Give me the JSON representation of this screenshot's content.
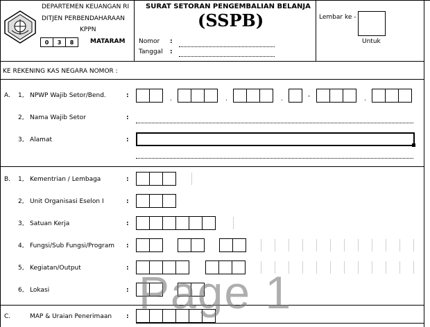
{
  "header": {
    "dept_line1": "DEPARTEMEN KEUANGAN RI",
    "dept_line2": "DITJEN PERBENDAHARAAN",
    "kppn_label": "KPPN",
    "kppn_code": [
      "0",
      "3",
      "8"
    ],
    "kppn_name": "MATARAM",
    "title": "SURAT SETORAN PENGEMBALIAN BELANJA",
    "subtitle": "(SSPB)",
    "nomor_label": "Nomor",
    "tanggal_label": "Tanggal",
    "lembar_label": "Lembar ke -",
    "untuk_label": "Untuk",
    "emblem_icon": "ministry-emblem-icon"
  },
  "rekening_label": "KE REKENING KAS NEGARA NOMOR :",
  "section_a": {
    "letter": "A.",
    "fields": [
      {
        "num": "1,",
        "label": "NPWP Wajib Setor/Bend."
      },
      {
        "num": "2,",
        "label": "Nama Wajib Setor"
      },
      {
        "num": "3,",
        "label": "Alamat"
      }
    ]
  },
  "section_b": {
    "letter": "B.",
    "fields": [
      {
        "num": "1,",
        "label": "Kementrian / Lembaga"
      },
      {
        "num": "2,",
        "label": "Unit Organisasi Eselon I"
      },
      {
        "num": "3,",
        "label": "Satuan Kerja"
      },
      {
        "num": "4,",
        "label": "Fungsi/Sub Fungsi/Program"
      },
      {
        "num": "5,",
        "label": "Kegiatan/Output"
      },
      {
        "num": "6,",
        "label": "Lokasi"
      }
    ]
  },
  "section_c": {
    "letter": "C.",
    "label": "MAP & Uraian Penerimaan"
  },
  "colon": ":",
  "npwp_separators": [
    ".",
    ".",
    ".",
    "-",
    "."
  ],
  "watermark": "Page 1"
}
